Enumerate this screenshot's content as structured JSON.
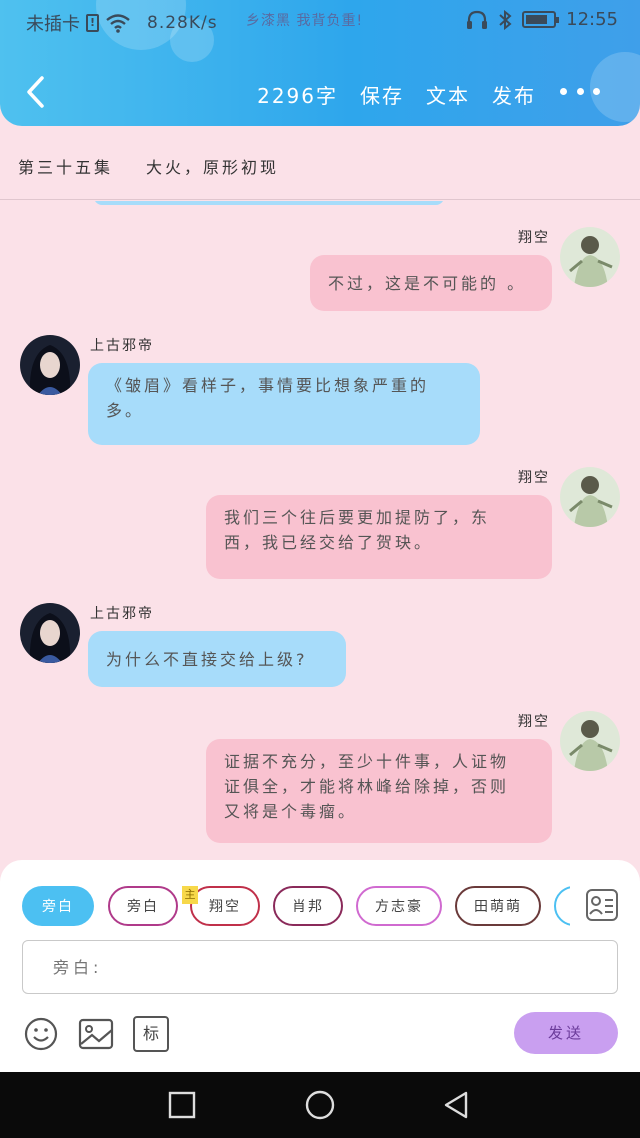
{
  "status_bar": {
    "carrier": "未插卡",
    "sim_icon_label": "!",
    "speed": "8.28K/s",
    "notice": "乡漆黑 我背负重!",
    "time": "12:55",
    "battery_level_percent": 80,
    "icons": [
      "sim-alert-icon",
      "wifi-icon",
      "headphones-icon",
      "bluetooth-icon",
      "battery-icon"
    ]
  },
  "header": {
    "word_count": "2296字",
    "save_label": "保存",
    "text_label": "文本",
    "publish_label": "发布",
    "back_icon": "chevron-left-icon",
    "more_icon": "more-dots-icon",
    "bg_colors": [
      "#4fc1ef",
      "#2ea6ec"
    ]
  },
  "chapter": {
    "number": "第三十五集",
    "title": "大火，原形初现"
  },
  "messages": [
    {
      "side": "right",
      "name": "翔空",
      "lines": [
        "不过，这是不可能的 。"
      ]
    },
    {
      "side": "left",
      "name": "上古邪帝",
      "lines": [
        "《皱眉》看样子，事情要比想象严重的",
        "多。"
      ]
    },
    {
      "side": "right",
      "name": "翔空",
      "lines": [
        "我们三个往后要更加提防了，东",
        "西，我已经交给了贺玦。"
      ]
    },
    {
      "side": "left",
      "name": "上古邪帝",
      "lines": [
        "为什么不直接交给上级?"
      ]
    },
    {
      "side": "right",
      "name": "翔空",
      "lines": [
        "证据不充分，至少十件事，人证物",
        "证俱全，才能将林峰给除掉，否则",
        "又将是个毒瘤。"
      ]
    }
  ],
  "characters": [
    {
      "label": "旁白",
      "active": true,
      "border": "#4cc0f2"
    },
    {
      "label": "旁白",
      "active": false,
      "border": "#b03a8a"
    },
    {
      "label": "翔空",
      "active": false,
      "border": "#c0304a"
    },
    {
      "label": "肖邦",
      "active": false,
      "border": "#8a2a5a"
    },
    {
      "label": "方志豪",
      "active": false,
      "border": "#d06ad0"
    },
    {
      "label": "田萌萌",
      "active": false,
      "border": "#6a3a3a"
    }
  ],
  "main_badge": "主",
  "input": {
    "placeholder": "旁白:"
  },
  "tools": [
    "emoji-icon",
    "image-icon",
    "mark-icon"
  ],
  "mark_label": "标",
  "send_label": "发送",
  "colors": {
    "background": "#fbe1e8",
    "bubble_right": "#f9c2d0",
    "bubble_left": "#a7dcfa",
    "send_button": "#c99ff0"
  }
}
